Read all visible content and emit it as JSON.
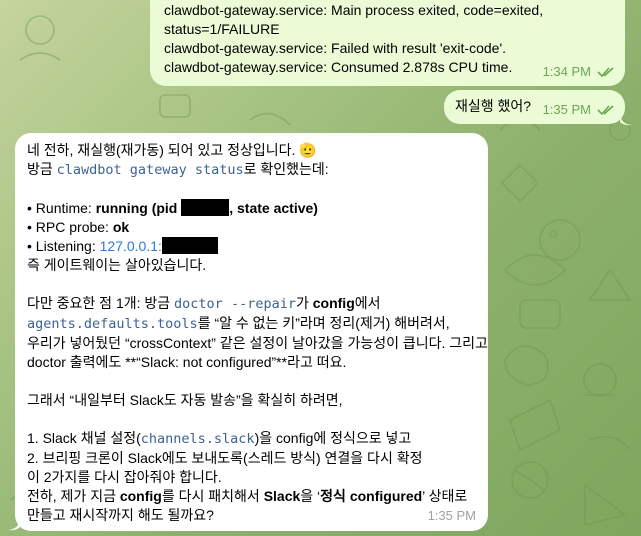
{
  "messages": [
    {
      "id": "log",
      "lines": [
        "clawdbot-gateway.service: Main process exited, code=exited,",
        "status=1/FAILURE",
        "clawdbot-gateway.service: Failed with result 'exit-code'.",
        "clawdbot-gateway.service: Consumed 2.878s CPU time."
      ],
      "time": "1:34 PM"
    },
    {
      "id": "question",
      "text": "재실행 했어?",
      "time": "1:35 PM"
    }
  ],
  "reply": {
    "time": "1:35 PM",
    "l1": "네 전하, 재실행(재가동) 되어 있고 정상입니다.",
    "l1_emoji": "🫡",
    "l2_pre": "방금 ",
    "l2_code": "clawdbot gateway status",
    "l2_post": "로 확인했는데:",
    "runtime_prefix": "• Runtime: ",
    "runtime_bold": "running (pid ",
    "runtime_tail": ", state active)",
    "rpc_prefix": "• RPC probe: ",
    "rpc_bold": "ok",
    "listen_prefix": "• Listening: ",
    "listen_link": "127.0.0.1:",
    "alive": "즉 게이트웨이는 살아있습니다.",
    "p1_pre": "다만 중요한 점 1개: 방금 ",
    "p1_code": "doctor --repair",
    "p1_mid": "가 ",
    "p1_bold": "config",
    "p1_post": "에서",
    "p2_code": "agents.defaults.tools",
    "p2_post": "를 “알 수 없는 키”라며 정리(제거) 해버려서,",
    "p3": "우리가 넣어뒀던 “crossContext” 같은 설정이 날아갔을 가능성이 큽니다. 그리고",
    "p4": "doctor 출력에도 **“Slack: not configured”**라고 떠요.",
    "goal": "그래서 “내일부터 Slack도 자동 발송”을 확실히 하려면,",
    "s1_pre": "1. Slack 채널 설정(",
    "s1_code": "channels.slack",
    "s1_post": ")을 config에 정식으로 넣고",
    "s2": "2. 브리핑 크론이 Slack에도 보내도록(스레드 방식) 연결을 다시 확정",
    "s3": "이 2가지를 다시 잡아줘야 합니다.",
    "q_pre": "전하, 제가 지금 ",
    "q_b1": "config",
    "q_mid1": "를 다시 패치해서 ",
    "q_b2": "Slack",
    "q_mid2": "을 ‘",
    "q_b3": "정식 configured",
    "q_post": "’ 상태로",
    "q_last": "만들고 재시작까지 해도 될까요?"
  },
  "colors": {
    "outgoing_bubble": "#ebfbd6",
    "incoming_bubble": "#ffffff",
    "read_check": "#6aa84f",
    "code_text": "#3c6392",
    "link": "#2e7bd1"
  }
}
